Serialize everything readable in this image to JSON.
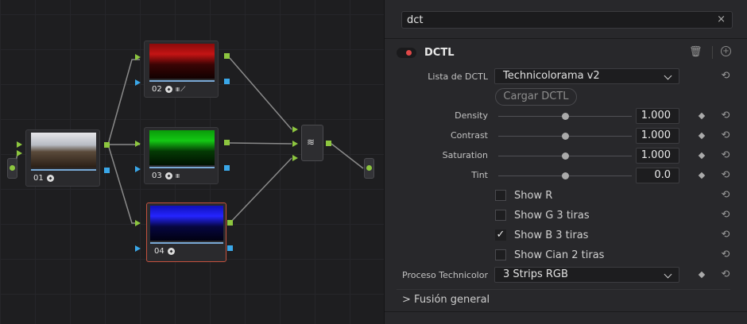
{
  "graph": {
    "nodes": [
      {
        "id": "01",
        "icons": ""
      },
      {
        "id": "02",
        "icons": "ııı ⟋"
      },
      {
        "id": "03",
        "icons": "ııı"
      },
      {
        "id": "04",
        "icons": ""
      }
    ],
    "mixer_icon": "mixer-icon",
    "colors": {
      "input_port": "#8dc63f",
      "key_port": "#3aa7e8",
      "selected_border": "#c4523e"
    }
  },
  "panel": {
    "search": {
      "value": "dct",
      "clear_icon": "×"
    },
    "header": {
      "title": "DCTL",
      "trash_icon": "🗑",
      "add_icon": "+"
    },
    "lista_label": "Lista de DCTL",
    "lista_value": "Technicolorama v2",
    "load_button": "Cargar DCTL",
    "params": [
      {
        "label": "Density",
        "value": "1.000"
      },
      {
        "label": "Contrast",
        "value": "1.000"
      },
      {
        "label": "Saturation",
        "value": "1.000"
      },
      {
        "label": "Tint",
        "value": "0.0"
      }
    ],
    "checkboxes": [
      {
        "label": "Show R",
        "checked": ""
      },
      {
        "label": "Show G 3 tiras",
        "checked": ""
      },
      {
        "label": "Show B 3 tiras",
        "checked": "✓"
      },
      {
        "label": "Show Cian 2 tiras",
        "checked": ""
      }
    ],
    "process_label": "Proceso Technicolor",
    "process_value": "3 Strips RGB",
    "section": "Fusión general",
    "section_chevron": ">",
    "reset_icon": "⟲"
  }
}
